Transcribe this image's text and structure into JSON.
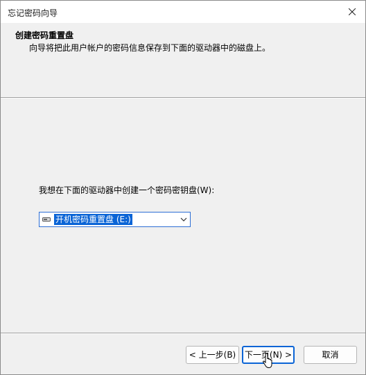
{
  "window": {
    "title": "忘记密码向导"
  },
  "header": {
    "title": "创建密码重置盘",
    "subtitle": "向导将把此用户帐户的密码信息保存到下面的驱动器中的磁盘上。"
  },
  "content": {
    "drive_label": "我想在下面的驱动器中创建一个密码密钥盘(W):",
    "drive_select": {
      "selected": "开机密码重置盘 (E:)",
      "icon": "drive-icon"
    }
  },
  "buttons": {
    "back": "< 上一步(B)",
    "next": "下一页(N) >",
    "cancel": "取消"
  },
  "colors": {
    "accent": "#0a64d6",
    "background": "#f0f0f0"
  }
}
